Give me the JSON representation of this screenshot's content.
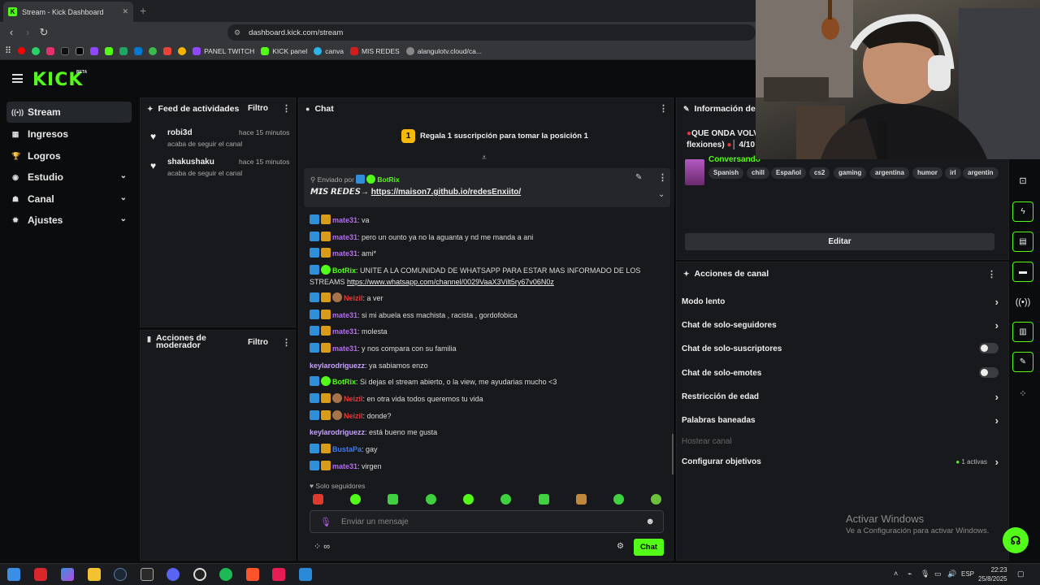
{
  "browser": {
    "tab_title": "Stream - Kick Dashboard",
    "url": "dashboard.kick.com/stream",
    "bookmarks": [
      {
        "label": "PANEL TWITCH",
        "color": "#9146ff"
      },
      {
        "label": "KICK panel",
        "color": "#53fc18"
      },
      {
        "label": "canva",
        "color": "#2bb5e8"
      },
      {
        "label": "MIS REDES",
        "color": "#d11f1f"
      },
      {
        "label": "alangulotv.cloud/ca...",
        "color": "#888888"
      }
    ]
  },
  "header": {
    "logo": "KICK",
    "beta": "BETA"
  },
  "sidebar": {
    "items": [
      {
        "label": "Stream"
      },
      {
        "label": "Ingresos"
      },
      {
        "label": "Logros"
      },
      {
        "label": "Estudio"
      },
      {
        "label": "Canal"
      },
      {
        "label": "Ajustes"
      }
    ]
  },
  "feed": {
    "title": "Feed de actividades",
    "filter": "Filtro",
    "items": [
      {
        "user": "robi3d",
        "time": "hace 15 minutos",
        "desc": "acaba de seguir el canal"
      },
      {
        "user": "shakushaku",
        "time": "hace 15 minutos",
        "desc": "acaba de seguir el canal"
      }
    ]
  },
  "mod": {
    "title": "Acciones de moderador",
    "filter": "Filtro"
  },
  "chat": {
    "title": "Chat",
    "goal_rank": "1",
    "goal_text": "Regala 1 suscripción para tomar la posición 1",
    "pinned": {
      "sent_by": "Enviado por",
      "user": "BotRix",
      "label": "𝙈𝙄𝙎 𝙍𝙀𝘿𝙀𝙎→",
      "link": "https://maison7.github.io/redesEnxiito/"
    },
    "messages": [
      {
        "user": "mate31",
        "text": "va"
      },
      {
        "user": "mate31",
        "text": "pero un ounto ya no la aguanta y nd me manda a ani"
      },
      {
        "user": "mate31",
        "text": "ami*"
      },
      {
        "user": "BotRix",
        "text": "UNITE A LA COMUNIDAD DE WHATSAPP PARA ESTAR MAS INFORMADO DE LOS STREAMS",
        "link": "https://www.whatsapp.com/channel/0029VaaX3Vilt5ry67v06N0z"
      },
      {
        "user": "Neizil",
        "text": "a ver"
      },
      {
        "user": "mate31",
        "text": "si mi abuela ess machista , racista , gordofobica"
      },
      {
        "user": "mate31",
        "text": "molesta"
      },
      {
        "user": "mate31",
        "text": "y nos compara con su familia"
      },
      {
        "user": "keylarodriguezz",
        "text": "ya sabiamos enzo"
      },
      {
        "user": "BotRix",
        "text": "Si dejas el stream abierto, o la view, me ayudarias mucho <3"
      },
      {
        "user": "Neizil",
        "text": "en otra vida todos queremos tu vida"
      },
      {
        "user": "Neizil",
        "text": "donde?"
      },
      {
        "user": "keylarodriguezz",
        "text": "está bueno me gusta"
      },
      {
        "user": "BustaPa",
        "text": "gay"
      },
      {
        "user": "mate31",
        "text": "virgen"
      }
    ],
    "followers_only": "Solo seguidores",
    "input_placeholder": "Enviar un mensaje",
    "send_label": "Chat",
    "infinity": "∞"
  },
  "info": {
    "title": "Información del s",
    "stream_title_line1": "QUE ONDA VOLV",
    "stream_title_line2": "flexiones)",
    "counter": "4/10",
    "category": "Conversando",
    "tags": [
      "Spanish",
      "chill",
      "Español",
      "cs2",
      "gaming",
      "argentina",
      "humor",
      "irl",
      "argentin"
    ],
    "edit_label": "Editar"
  },
  "actions": {
    "title": "Acciones de canal",
    "rows": [
      {
        "label": "Modo lento",
        "kind": "arrow"
      },
      {
        "label": "Chat de solo-seguidores",
        "kind": "arrow"
      },
      {
        "label": "Chat de solo-suscriptores",
        "kind": "toggle"
      },
      {
        "label": "Chat de solo-emotes",
        "kind": "toggle"
      },
      {
        "label": "Restricción de edad",
        "kind": "arrow"
      },
      {
        "label": "Palabras baneadas",
        "kind": "arrow"
      },
      {
        "label": "Hostear canal",
        "kind": "disabled"
      },
      {
        "label": "Configurar objetivos",
        "kind": "arrow",
        "badge": "1 activas"
      }
    ]
  },
  "windows": {
    "activate_title": "Activar Windows",
    "activate_sub": "Ve a Configuración para activar Windows.",
    "lang": "ESP",
    "time": "22:23",
    "date": "25/8/2025"
  }
}
